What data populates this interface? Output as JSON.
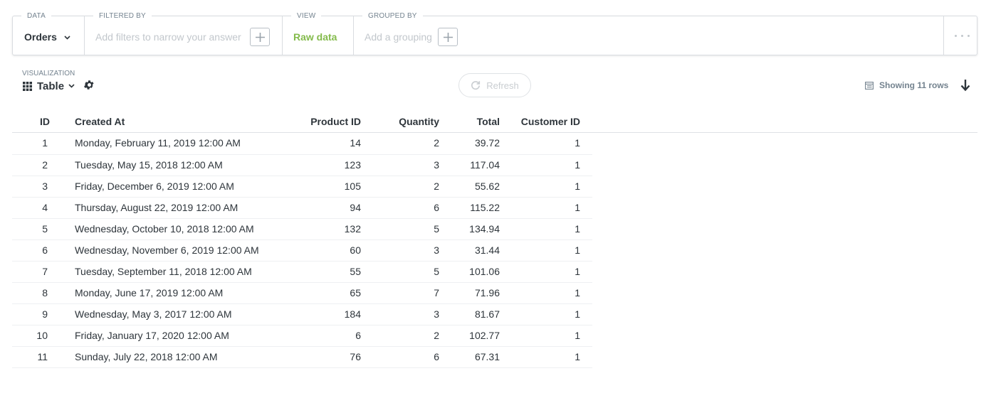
{
  "query_builder": {
    "data": {
      "label": "DATA",
      "value": "Orders"
    },
    "filter": {
      "label": "FILTERED BY",
      "placeholder": "Add filters to narrow your answer"
    },
    "view": {
      "label": "VIEW",
      "value": "Raw data"
    },
    "group": {
      "label": "GROUPED BY",
      "placeholder": "Add a grouping"
    }
  },
  "toolbar": {
    "visualization_label": "VISUALIZATION",
    "visualization_value": "Table",
    "refresh_label": "Refresh",
    "rows_info": "Showing 11 rows"
  },
  "table": {
    "columns": [
      "ID",
      "Created At",
      "Product ID",
      "Quantity",
      "Total",
      "Customer ID"
    ],
    "rows": [
      [
        "1",
        "Monday, February 11, 2019 12:00 AM",
        "14",
        "2",
        "39.72",
        "1"
      ],
      [
        "2",
        "Tuesday, May 15, 2018 12:00 AM",
        "123",
        "3",
        "117.04",
        "1"
      ],
      [
        "3",
        "Friday, December 6, 2019 12:00 AM",
        "105",
        "2",
        "55.62",
        "1"
      ],
      [
        "4",
        "Thursday, August 22, 2019 12:00 AM",
        "94",
        "6",
        "115.22",
        "1"
      ],
      [
        "5",
        "Wednesday, October 10, 2018 12:00 AM",
        "132",
        "5",
        "134.94",
        "1"
      ],
      [
        "6",
        "Wednesday, November 6, 2019 12:00 AM",
        "60",
        "3",
        "31.44",
        "1"
      ],
      [
        "7",
        "Tuesday, September 11, 2018 12:00 AM",
        "55",
        "5",
        "101.06",
        "1"
      ],
      [
        "8",
        "Monday, June 17, 2019 12:00 AM",
        "65",
        "7",
        "71.96",
        "1"
      ],
      [
        "9",
        "Wednesday, May 3, 2017 12:00 AM",
        "184",
        "3",
        "81.67",
        "1"
      ],
      [
        "10",
        "Friday, January 17, 2020 12:00 AM",
        "6",
        "2",
        "102.77",
        "1"
      ],
      [
        "11",
        "Sunday, July 22, 2018 12:00 AM",
        "76",
        "6",
        "67.31",
        "1"
      ]
    ]
  },
  "icons": {
    "chevron": "chevron-down-icon",
    "plus": "plus-icon",
    "grid": "table-grid-icon",
    "gear": "gear-icon",
    "refresh": "refresh-icon",
    "rows": "list-icon",
    "download": "download-icon",
    "more": "more-dots-icon"
  },
  "colors": {
    "raw_data_green": "#84bb4c",
    "text_dark": "#2e353b",
    "placeholder": "#c2c7cc",
    "border": "#d9dce0"
  }
}
